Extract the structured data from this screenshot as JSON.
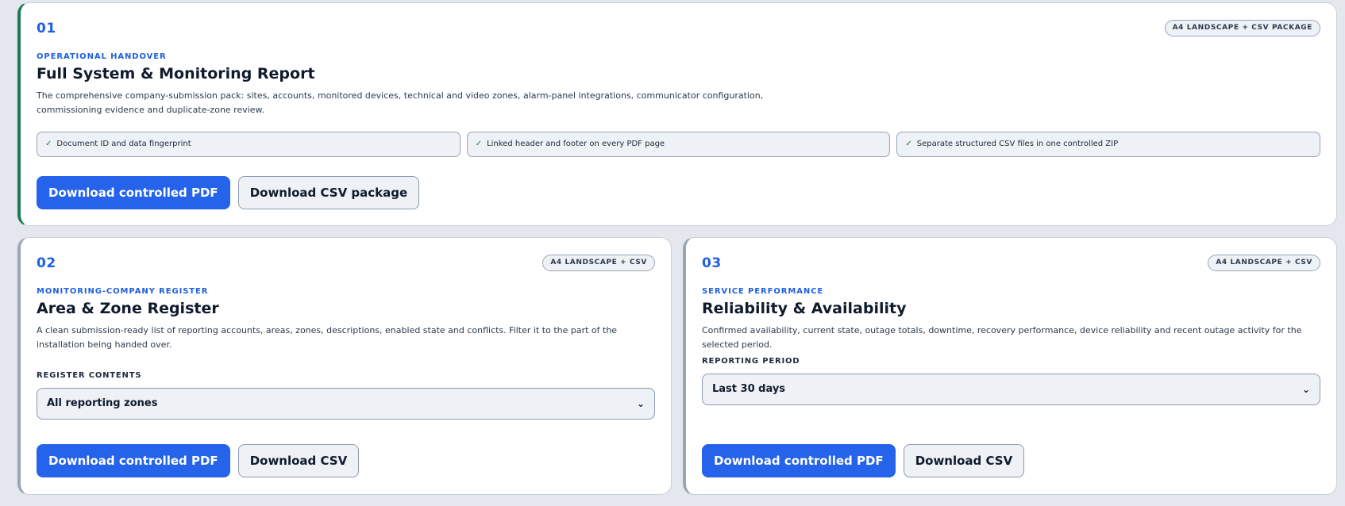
{
  "cards": [
    {
      "number": "01",
      "badge": "A4 LANDSCAPE + CSV PACKAGE",
      "eyebrow": "OPERATIONAL HANDOVER",
      "title": "Full System & Monitoring Report",
      "description": "The comprehensive company-submission pack: sites, accounts, monitored devices, technical and video zones, alarm-panel integrations, communicator configuration, commissioning evidence and duplicate-zone review.",
      "features": [
        "Document ID and data fingerprint",
        "Linked header and footer on every PDF page",
        "Separate structured CSV files in one controlled ZIP"
      ],
      "buttons": [
        "Download controlled PDF",
        "Download CSV package"
      ]
    },
    {
      "number": "02",
      "badge": "A4 LANDSCAPE + CSV",
      "eyebrow": "MONITORING-COMPANY REGISTER",
      "title": "Area & Zone Register",
      "description": "A clean submission-ready list of reporting accounts, areas, zones, descriptions, enabled state and conflicts. Filter it to the part of the installation being handed over.",
      "field_label": "REGISTER CONTENTS",
      "select_value": "All reporting zones",
      "buttons": [
        "Download controlled PDF",
        "Download CSV"
      ]
    },
    {
      "number": "03",
      "badge": "A4 LANDSCAPE + CSV",
      "eyebrow": "SERVICE PERFORMANCE",
      "title": "Reliability & Availability",
      "description": "Confirmed availability, current state, outage totals, downtime, recovery performance, device reliability and recent outage activity for the selected period.",
      "field_label": "REPORTING PERIOD",
      "select_value": "Last 30 days",
      "buttons": [
        "Download controlled PDF",
        "Download CSV"
      ]
    }
  ],
  "icons": {
    "check": "check-icon",
    "chevron": "chevron-down-icon"
  },
  "colors": {
    "accent": "#1f5fe0",
    "primary_button": "#2563eb",
    "primary_card_stripe": "#1f7a52",
    "check": "#1a7a45",
    "background": "#e4e8ee"
  }
}
